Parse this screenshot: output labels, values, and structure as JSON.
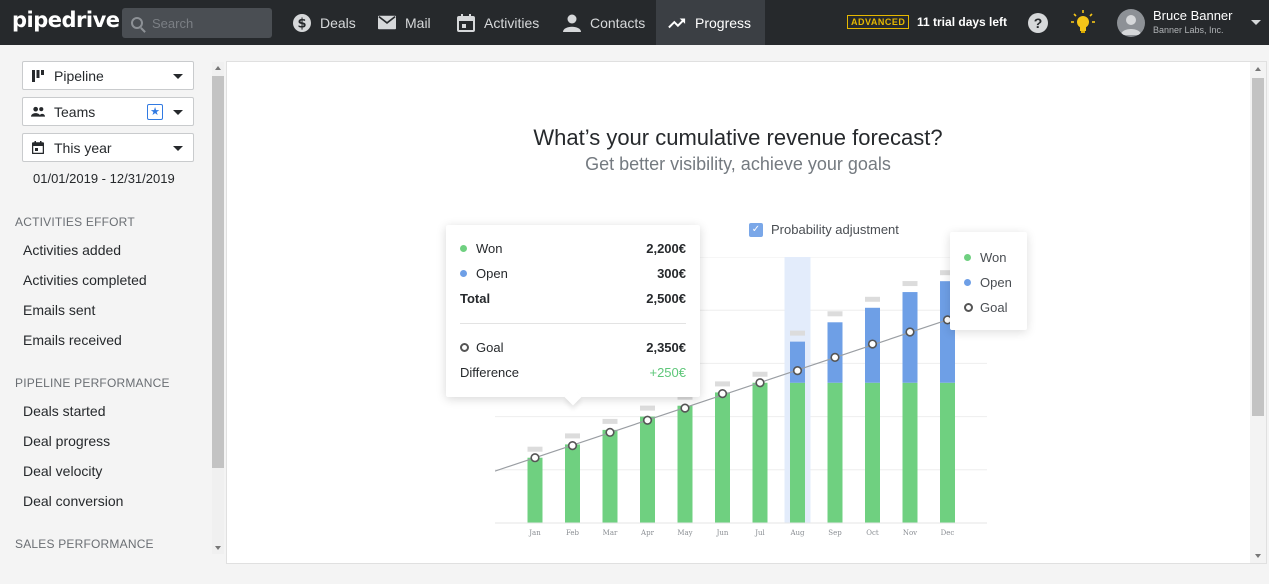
{
  "topbar": {
    "logo": "pipedrive",
    "search_placeholder": "Search",
    "nav": [
      {
        "label": "Deals",
        "icon": "dollar-icon"
      },
      {
        "label": "Mail",
        "icon": "mail-icon"
      },
      {
        "label": "Activities",
        "icon": "calendar-icon"
      },
      {
        "label": "Contacts",
        "icon": "person-icon"
      },
      {
        "label": "Progress",
        "icon": "trending-up-icon",
        "active": true
      }
    ],
    "plan_badge": "ADVANCED",
    "trial_text": "11 trial days left",
    "user_name": "Bruce Banner",
    "user_company": "Banner Labs, Inc."
  },
  "sidebar": {
    "filters": [
      {
        "label": "Pipeline",
        "icon": "pipeline-icon"
      },
      {
        "label": "Teams",
        "icon": "team-icon"
      },
      {
        "label": "This year",
        "icon": "calendar-icon"
      }
    ],
    "date_range": "01/01/2019 - 12/31/2019",
    "sections": [
      {
        "title": "ACTIVITIES EFFORT",
        "items": [
          "Activities added",
          "Activities completed",
          "Emails sent",
          "Emails received"
        ]
      },
      {
        "title": "PIPELINE PERFORMANCE",
        "items": [
          "Deals started",
          "Deal progress",
          "Deal velocity",
          "Deal conversion"
        ]
      },
      {
        "title": "SALES PERFORMANCE",
        "items": []
      }
    ]
  },
  "main": {
    "headline": "What’s your cumulative revenue forecast?",
    "subline": "Get better visibility, achieve your goals",
    "probability_label": "Probability adjustment",
    "tooltip": {
      "won_label": "Won",
      "won_value": "2,200€",
      "open_label": "Open",
      "open_value": "300€",
      "total_label": "Total",
      "total_value": "2,500€",
      "goal_label": "Goal",
      "goal_value": "2,350€",
      "diff_label": "Difference",
      "diff_value": "+250€"
    },
    "legend": [
      "Won",
      "Open",
      "Goal"
    ]
  },
  "colors": {
    "won": "#6fd080",
    "open": "#6e9fe6",
    "goal_ring": "#555555",
    "highlight": "#e3ecfb",
    "positive": "#5fc77a"
  },
  "chart_data": {
    "type": "bar",
    "categories": [
      "Jan",
      "Feb",
      "Mar",
      "Apr",
      "May",
      "Jun",
      "Jul",
      "Aug",
      "Sep",
      "Oct",
      "Nov",
      "Dec"
    ],
    "series": [
      {
        "name": "Won",
        "values": [
          54,
          65,
          77,
          88,
          97,
          108,
          116,
          116,
          116,
          116,
          116,
          116
        ]
      },
      {
        "name": "Open",
        "values": [
          0,
          0,
          0,
          0,
          0,
          0,
          0,
          34,
          50,
          62,
          75,
          84
        ]
      },
      {
        "name": "Goal",
        "values": [
          54,
          64,
          75,
          85,
          95,
          107,
          116,
          126,
          137,
          148,
          158,
          168
        ]
      }
    ],
    "highlighted_category": "Aug",
    "ylim": [
      0,
      220
    ],
    "grid": true
  }
}
